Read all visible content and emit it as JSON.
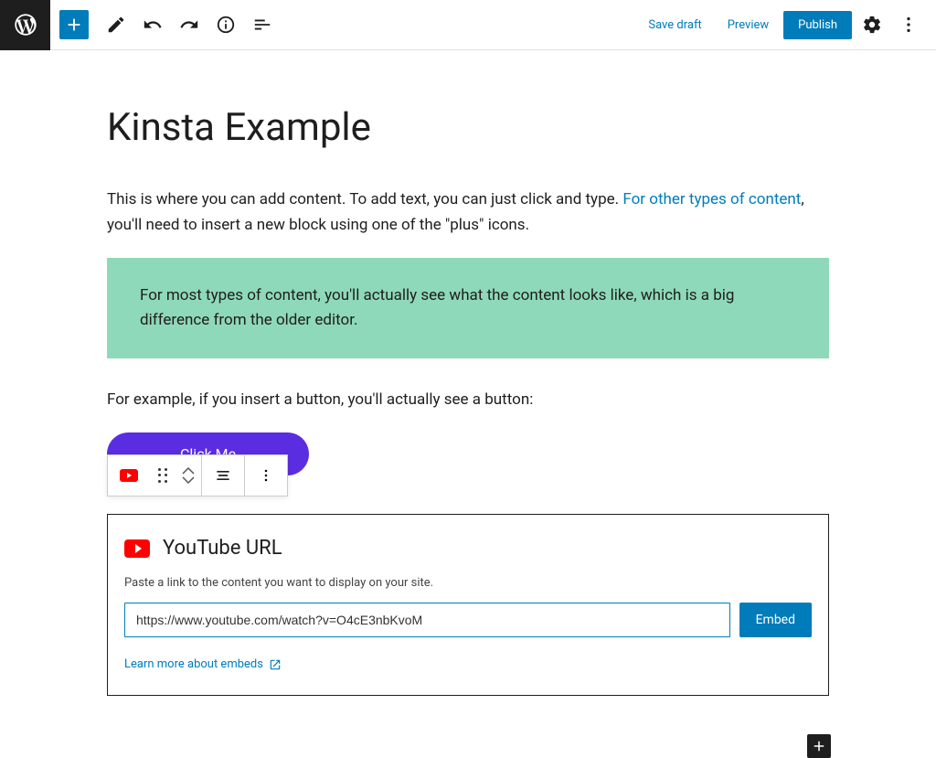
{
  "topbar": {
    "save_draft": "Save draft",
    "preview": "Preview",
    "publish": "Publish"
  },
  "post": {
    "title": "Kinsta Example",
    "para1_a": "This is where you can add content. To add text, you can just click and type. ",
    "para1_link": "For other types of content",
    "para1_b": ", you'll need to insert a new block using one of the \"plus\" icons.",
    "highlight": "For most types of content, you'll actually see what the content looks like, which is a big difference from the older editor.",
    "para2": "For example, if you insert a button, you'll actually see a button:",
    "button_label": "Click Me"
  },
  "embed": {
    "title": "YouTube URL",
    "desc": "Paste a link to the content you want to display on your site.",
    "value": "https://www.youtube.com/watch?v=O4cE3nbKvoM",
    "submit": "Embed",
    "learn_more": "Learn more about embeds"
  }
}
